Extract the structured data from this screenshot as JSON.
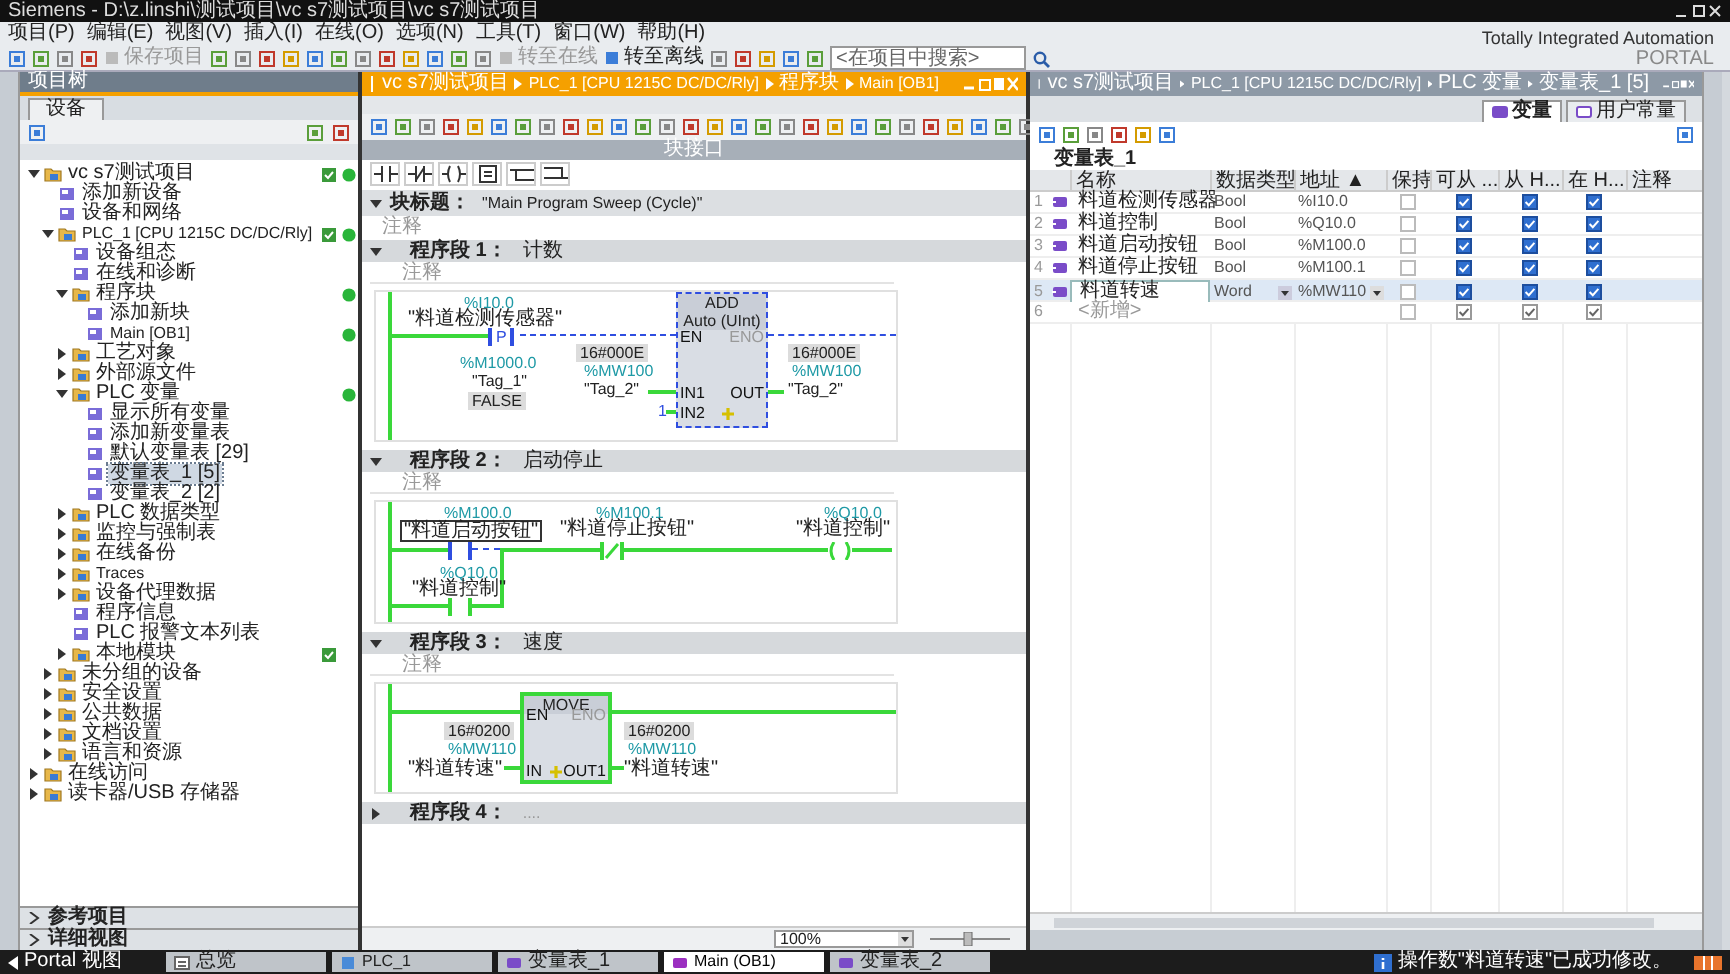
{
  "window": {
    "title": "Siemens  -  D:\\z.linshi\\测试项目\\vc s7测试项目\\vc s7测试项目"
  },
  "menu": [
    "项目(P)",
    "编辑(E)",
    "视图(V)",
    "插入(I)",
    "在线(O)",
    "选项(N)",
    "工具(T)",
    "窗口(W)",
    "帮助(H)"
  ],
  "toolbar": {
    "buttons": [
      {
        "label": "保存项目",
        "disabled": true
      },
      {
        "label": "转至在线",
        "disabled": true
      },
      {
        "label": "转至离线",
        "disabled": false
      }
    ],
    "search_placeholder": "<在项目中搜索>"
  },
  "brand": {
    "line1": "Totally Integrated Automation",
    "line2": "PORTAL"
  },
  "project_tree": {
    "title": "项目树",
    "tab": "设备",
    "nodes": [
      {
        "label": "vc s7测试项目",
        "expanded": true,
        "compiled": true,
        "online": true,
        "selected": false,
        "children": [
          {
            "label": "添加新设备",
            "compiled": false,
            "online": false,
            "selected": false
          },
          {
            "label": "设备和网络",
            "compiled": false,
            "online": false,
            "selected": false
          },
          {
            "label": "PLC_1 [CPU 1215C DC/DC/Rly]",
            "expanded": true,
            "compiled": true,
            "online": true,
            "selected": false,
            "children": [
              {
                "label": "设备组态",
                "compiled": false,
                "online": false,
                "selected": false
              },
              {
                "label": "在线和诊断",
                "compiled": false,
                "online": false,
                "selected": false
              },
              {
                "label": "程序块",
                "expanded": true,
                "compiled": false,
                "online": true,
                "selected": false,
                "children": [
                  {
                    "label": "添加新块",
                    "compiled": false,
                    "online": false,
                    "selected": false
                  },
                  {
                    "label": "Main [OB1]",
                    "compiled": false,
                    "online": true,
                    "selected": false
                  }
                ]
              },
              {
                "label": "工艺对象",
                "expanded": false,
                "compiled": false,
                "online": false,
                "selected": false
              },
              {
                "label": "外部源文件",
                "expanded": false,
                "compiled": false,
                "online": false,
                "selected": false
              },
              {
                "label": "PLC 变量",
                "expanded": true,
                "compiled": false,
                "online": true,
                "selected": false,
                "children": [
                  {
                    "label": "显示所有变量",
                    "compiled": false,
                    "online": false,
                    "selected": false
                  },
                  {
                    "label": "添加新变量表",
                    "compiled": false,
                    "online": false,
                    "selected": false
                  },
                  {
                    "label": "默认变量表 [29]",
                    "compiled": false,
                    "online": false,
                    "selected": false
                  },
                  {
                    "label": "变量表_1 [5]",
                    "compiled": false,
                    "online": false,
                    "selected": true
                  },
                  {
                    "label": "变量表_2 [2]",
                    "compiled": false,
                    "online": false,
                    "selected": false
                  }
                ]
              },
              {
                "label": "PLC 数据类型",
                "expanded": false,
                "compiled": false,
                "online": false,
                "selected": false
              },
              {
                "label": "监控与强制表",
                "expanded": false,
                "compiled": false,
                "online": false,
                "selected": false
              },
              {
                "label": "在线备份",
                "expanded": false,
                "compiled": false,
                "online": false,
                "selected": false
              },
              {
                "label": "Traces",
                "expanded": false,
                "compiled": false,
                "online": false,
                "selected": false
              },
              {
                "label": "设备代理数据",
                "expanded": false,
                "compiled": false,
                "online": false,
                "selected": false
              },
              {
                "label": "程序信息",
                "compiled": false,
                "online": false,
                "selected": false
              },
              {
                "label": "PLC 报警文本列表",
                "compiled": false,
                "online": false,
                "selected": false
              },
              {
                "label": "本地模块",
                "expanded": false,
                "compiled": true,
                "online": false,
                "selected": false
              }
            ]
          },
          {
            "label": "未分组的设备",
            "expanded": false,
            "compiled": false,
            "online": false,
            "selected": false
          },
          {
            "label": "安全设置",
            "expanded": false,
            "compiled": false,
            "online": false,
            "selected": false
          },
          {
            "label": "公共数据",
            "expanded": false,
            "compiled": false,
            "online": false,
            "selected": false
          },
          {
            "label": "文档设置",
            "expanded": false,
            "compiled": false,
            "online": false,
            "selected": false
          },
          {
            "label": "语言和资源",
            "expanded": false,
            "compiled": false,
            "online": false,
            "selected": false
          }
        ]
      },
      {
        "label": "在线访问",
        "expanded": false,
        "compiled": false,
        "online": false,
        "selected": false
      },
      {
        "label": "读卡器/USB 存储器",
        "expanded": false,
        "compiled": false,
        "online": false,
        "selected": false
      }
    ],
    "bottom_sections": [
      "参考项目",
      "详细视图"
    ]
  },
  "editor": {
    "breadcrumb": [
      "vc s7测试项目",
      "PLC_1 [CPU 1215C DC/DC/Rly]",
      "程序块",
      "Main [OB1]"
    ],
    "active": true,
    "block_interface": "块接口",
    "block_title_label": "块标题：",
    "block_title": "\"Main Program Sweep (Cycle)\"",
    "block_comment": "注释",
    "networks": [
      {
        "kind": "add",
        "title": "程序段 1：",
        "name": "计数",
        "comment": "注释",
        "expanded": true,
        "contact": {
          "address": "%I10.0",
          "tag": "\"料道检测传感器\"",
          "symbol": "P",
          "selected": true,
          "edge_address": "%M1000.0",
          "edge_tag": "\"Tag_1\"",
          "edge_value": "FALSE"
        },
        "box": {
          "name": "ADD",
          "type": "Auto (UInt)",
          "selected": true,
          "en": "EN",
          "eno": "ENO",
          "in1": "IN1",
          "in2": "IN2",
          "out": "OUT"
        },
        "in1": {
          "value": "16#000E",
          "address": "%MW100",
          "tag": "\"Tag_2\""
        },
        "in2": "1",
        "out": {
          "value": "16#000E",
          "address": "%MW100",
          "tag": "\"Tag_2\""
        }
      },
      {
        "kind": "start_stop",
        "title": "程序段 2：",
        "name": "启动停止",
        "comment": "注释",
        "expanded": true,
        "contacts": [
          {
            "address": "%M100.0",
            "tag": "\"料道启动按钮\"",
            "selected": true
          },
          {
            "address": "%M100.1",
            "tag": "\"料道停止按钮\"",
            "selected": false
          }
        ],
        "coil": {
          "address": "%Q10.0",
          "tag": "\"料道控制\""
        },
        "parallel": {
          "address": "%Q10.0",
          "tag": "\"料道控制\"",
          "selected": false
        }
      },
      {
        "kind": "move",
        "title": "程序段 3：",
        "name": "速度",
        "comment": "注释",
        "expanded": true,
        "box": {
          "name": "MOVE",
          "selected": false,
          "en": "EN",
          "eno": "ENO",
          "in": "IN",
          "out": "OUT1"
        },
        "in": {
          "value": "16#0200",
          "address": "%MW110",
          "tag": "\"料道转速\""
        },
        "out": {
          "value": "16#0200",
          "address": "%MW110",
          "tag": "\"料道转速\""
        }
      },
      {
        "kind": "collapsed",
        "title": "程序段 4：",
        "name": "....",
        "expanded": false
      }
    ],
    "zoom": "100%"
  },
  "tag_table_window": {
    "breadcrumb": [
      "vc s7测试项目",
      "PLC_1 [CPU 1215C DC/DC/Rly]",
      "PLC 变量",
      "变量表_1 [5]"
    ],
    "active": false,
    "tabs": [
      {
        "label": "变量",
        "selected": true
      },
      {
        "label": "用户常量",
        "selected": false
      }
    ],
    "table_title": "变量表_1",
    "columns": [
      "名称",
      "数据类型",
      "地址 ▲",
      "保持",
      "可从 ...",
      "从 H...",
      "在 H...",
      "注释"
    ],
    "rows": [
      {
        "kind": "variable",
        "number": "1",
        "name": "料道检测传感器",
        "data_type": "Bool",
        "address": "%I10.0",
        "retain": false,
        "accessible": true,
        "writable": true,
        "visible": true,
        "selected": false
      },
      {
        "kind": "variable",
        "number": "2",
        "name": "料道控制",
        "data_type": "Bool",
        "address": "%Q10.0",
        "retain": false,
        "accessible": true,
        "writable": true,
        "visible": true,
        "selected": false
      },
      {
        "kind": "variable",
        "number": "3",
        "name": "料道启动按钮",
        "data_type": "Bool",
        "address": "%M100.0",
        "retain": false,
        "accessible": true,
        "writable": true,
        "visible": true,
        "selected": false
      },
      {
        "kind": "variable",
        "number": "4",
        "name": "料道停止按钮",
        "data_type": "Bool",
        "address": "%M100.1",
        "retain": false,
        "accessible": true,
        "writable": true,
        "visible": true,
        "selected": false
      },
      {
        "kind": "variable",
        "number": "5",
        "name": "料道转速",
        "data_type": "Word",
        "address": "%MW110",
        "retain": false,
        "accessible": true,
        "writable": true,
        "visible": true,
        "selected": true
      },
      {
        "kind": "add_new",
        "number": "6",
        "name": "<新增>",
        "retain": false,
        "accessible": true,
        "writable": true,
        "visible": true,
        "selected": false
      }
    ]
  },
  "taskbar": {
    "portal_view": "Portal 视图",
    "items": [
      {
        "label": "总览",
        "kind": "overview",
        "selected": false
      },
      {
        "label": "PLC_1",
        "kind": "device",
        "selected": false
      },
      {
        "label": "变量表_1",
        "kind": "table",
        "selected": false
      },
      {
        "label": "Main (OB1)",
        "kind": "block",
        "selected": true
      },
      {
        "label": "变量表_2",
        "kind": "table",
        "selected": false
      }
    ],
    "message": "操作数\"料道转速\"已成功修改。"
  }
}
